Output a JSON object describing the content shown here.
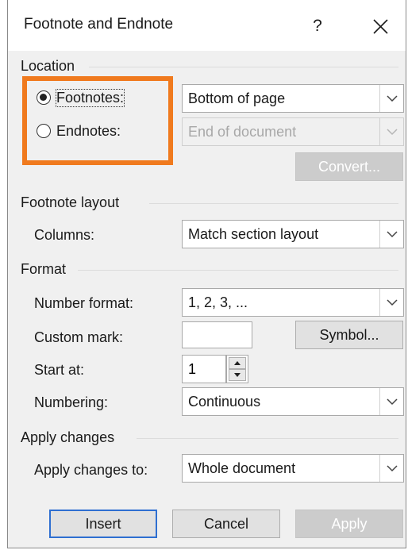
{
  "dialog": {
    "title": "Footnote and Endnote",
    "help_label": "?",
    "close_label": "✕"
  },
  "location": {
    "heading": "Location",
    "footnotes": {
      "label": "Footnotes:",
      "selected": true,
      "position": "Bottom of page"
    },
    "endnotes": {
      "label": "Endnotes:",
      "selected": false,
      "position": "End of document"
    },
    "convert_label": "Convert..."
  },
  "footnote_layout": {
    "heading": "Footnote layout",
    "columns_label": "Columns:",
    "columns_value": "Match section layout"
  },
  "format": {
    "heading": "Format",
    "number_format_label": "Number format:",
    "number_format_value": "1, 2, 3, ...",
    "custom_mark_label": "Custom mark:",
    "custom_mark_value": "",
    "symbol_label": "Symbol...",
    "start_at_label": "Start at:",
    "start_at_value": "1",
    "numbering_label": "Numbering:",
    "numbering_value": "Continuous"
  },
  "apply_changes": {
    "heading": "Apply changes",
    "apply_to_label": "Apply changes to:",
    "apply_to_value": "Whole document"
  },
  "buttons": {
    "insert": "Insert",
    "cancel": "Cancel",
    "apply": "Apply"
  },
  "colors": {
    "highlight_box": "#f07a1e",
    "default_button_border": "#2e6fd1"
  }
}
